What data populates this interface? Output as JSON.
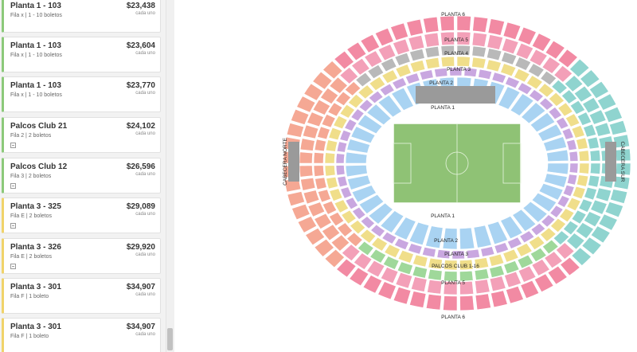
{
  "listings": [
    {
      "section": "Planta 1 - 103",
      "row": "Fila x | 1 - 10 boletos",
      "price": "$23,438",
      "each": "cada uno",
      "note": false,
      "accent": "#8cc97a"
    },
    {
      "section": "Planta 1 - 103",
      "row": "Fila x | 1 - 10 boletos",
      "price": "$23,604",
      "each": "cada uno",
      "note": false,
      "accent": "#8cc97a"
    },
    {
      "section": "Planta 1 - 103",
      "row": "Fila x | 1 - 10 boletos",
      "price": "$23,770",
      "each": "cada uno",
      "note": false,
      "accent": "#8cc97a"
    },
    {
      "section": "Palcos Club 21",
      "row": "Fila 2 | 2 boletos",
      "price": "$24,102",
      "each": "cada uno",
      "note": true,
      "accent": "#8cc97a"
    },
    {
      "section": "Palcos Club 12",
      "row": "Fila 3 | 2 boletos",
      "price": "$26,596",
      "each": "cada uno",
      "note": true,
      "accent": "#8cc97a"
    },
    {
      "section": "Planta 3 - 325",
      "row": "Fila E | 2 boletos",
      "price": "$29,089",
      "each": "cada uno",
      "note": true,
      "accent": "#f0d36a"
    },
    {
      "section": "Planta 3 - 326",
      "row": "Fila E | 2 boletos",
      "price": "$29,920",
      "each": "cada uno",
      "note": true,
      "accent": "#f0d36a"
    },
    {
      "section": "Planta 3 - 301",
      "row": "Fila F | 1 boleto",
      "price": "$34,907",
      "each": "cada uno",
      "note": false,
      "accent": "#f0d36a"
    },
    {
      "section": "Planta 3 - 301",
      "row": "Fila F | 1 boleto",
      "price": "$34,907",
      "each": "cada uno",
      "note": false,
      "accent": "#f0d36a"
    }
  ],
  "map": {
    "labels": {
      "planta6_top": "PLANTA 6",
      "planta5_top": "PLANTA 5",
      "planta4_top": "PLANTA 4",
      "planta3_top": "PLANTA 3",
      "planta2_top": "PLANTA 2",
      "planta1_top": "PLANTA 1",
      "planta1_bottom": "PLANTA 1",
      "planta2_bottom": "PLANTA 2",
      "planta3_bottom": "PLANTA 3",
      "palcos_bottom": "PALCOS CLUB 1-16",
      "planta5_bottom": "PLANTA 5",
      "planta6_bottom": "PLANTA 6",
      "cabecera_norte": "CABECERA NORTE",
      "cabecera_sur": "CABECERA SUR"
    },
    "colors": {
      "planta1": "#a9d3f2",
      "planta2": "#c9a7e0",
      "planta3": "#f0de8a",
      "palcos": "#9fd89a",
      "planta4": "#b9b9b9",
      "planta5": "#f3a0b8",
      "planta6": "#f28aa3",
      "cabecera": "#f5a894",
      "sur": "#8fd4cf",
      "field": "#8fc275"
    }
  }
}
